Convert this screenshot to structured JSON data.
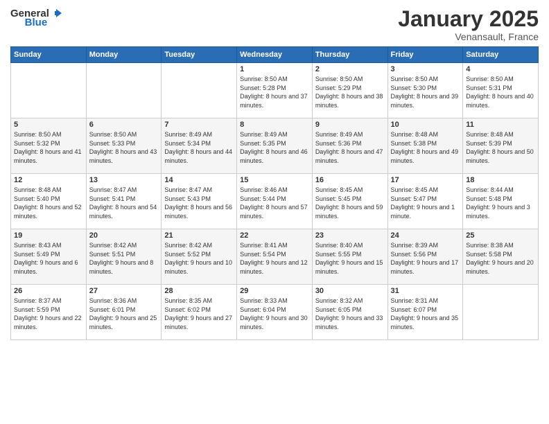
{
  "header": {
    "logo_general": "General",
    "logo_blue": "Blue",
    "title": "January 2025",
    "subtitle": "Venansault, France"
  },
  "days_of_week": [
    "Sunday",
    "Monday",
    "Tuesday",
    "Wednesday",
    "Thursday",
    "Friday",
    "Saturday"
  ],
  "weeks": [
    [
      {
        "day": "",
        "info": ""
      },
      {
        "day": "",
        "info": ""
      },
      {
        "day": "",
        "info": ""
      },
      {
        "day": "1",
        "info": "Sunrise: 8:50 AM\nSunset: 5:28 PM\nDaylight: 8 hours and 37 minutes."
      },
      {
        "day": "2",
        "info": "Sunrise: 8:50 AM\nSunset: 5:29 PM\nDaylight: 8 hours and 38 minutes."
      },
      {
        "day": "3",
        "info": "Sunrise: 8:50 AM\nSunset: 5:30 PM\nDaylight: 8 hours and 39 minutes."
      },
      {
        "day": "4",
        "info": "Sunrise: 8:50 AM\nSunset: 5:31 PM\nDaylight: 8 hours and 40 minutes."
      }
    ],
    [
      {
        "day": "5",
        "info": "Sunrise: 8:50 AM\nSunset: 5:32 PM\nDaylight: 8 hours and 41 minutes."
      },
      {
        "day": "6",
        "info": "Sunrise: 8:50 AM\nSunset: 5:33 PM\nDaylight: 8 hours and 43 minutes."
      },
      {
        "day": "7",
        "info": "Sunrise: 8:49 AM\nSunset: 5:34 PM\nDaylight: 8 hours and 44 minutes."
      },
      {
        "day": "8",
        "info": "Sunrise: 8:49 AM\nSunset: 5:35 PM\nDaylight: 8 hours and 46 minutes."
      },
      {
        "day": "9",
        "info": "Sunrise: 8:49 AM\nSunset: 5:36 PM\nDaylight: 8 hours and 47 minutes."
      },
      {
        "day": "10",
        "info": "Sunrise: 8:48 AM\nSunset: 5:38 PM\nDaylight: 8 hours and 49 minutes."
      },
      {
        "day": "11",
        "info": "Sunrise: 8:48 AM\nSunset: 5:39 PM\nDaylight: 8 hours and 50 minutes."
      }
    ],
    [
      {
        "day": "12",
        "info": "Sunrise: 8:48 AM\nSunset: 5:40 PM\nDaylight: 8 hours and 52 minutes."
      },
      {
        "day": "13",
        "info": "Sunrise: 8:47 AM\nSunset: 5:41 PM\nDaylight: 8 hours and 54 minutes."
      },
      {
        "day": "14",
        "info": "Sunrise: 8:47 AM\nSunset: 5:43 PM\nDaylight: 8 hours and 56 minutes."
      },
      {
        "day": "15",
        "info": "Sunrise: 8:46 AM\nSunset: 5:44 PM\nDaylight: 8 hours and 57 minutes."
      },
      {
        "day": "16",
        "info": "Sunrise: 8:45 AM\nSunset: 5:45 PM\nDaylight: 8 hours and 59 minutes."
      },
      {
        "day": "17",
        "info": "Sunrise: 8:45 AM\nSunset: 5:47 PM\nDaylight: 9 hours and 1 minute."
      },
      {
        "day": "18",
        "info": "Sunrise: 8:44 AM\nSunset: 5:48 PM\nDaylight: 9 hours and 3 minutes."
      }
    ],
    [
      {
        "day": "19",
        "info": "Sunrise: 8:43 AM\nSunset: 5:49 PM\nDaylight: 9 hours and 6 minutes."
      },
      {
        "day": "20",
        "info": "Sunrise: 8:42 AM\nSunset: 5:51 PM\nDaylight: 9 hours and 8 minutes."
      },
      {
        "day": "21",
        "info": "Sunrise: 8:42 AM\nSunset: 5:52 PM\nDaylight: 9 hours and 10 minutes."
      },
      {
        "day": "22",
        "info": "Sunrise: 8:41 AM\nSunset: 5:54 PM\nDaylight: 9 hours and 12 minutes."
      },
      {
        "day": "23",
        "info": "Sunrise: 8:40 AM\nSunset: 5:55 PM\nDaylight: 9 hours and 15 minutes."
      },
      {
        "day": "24",
        "info": "Sunrise: 8:39 AM\nSunset: 5:56 PM\nDaylight: 9 hours and 17 minutes."
      },
      {
        "day": "25",
        "info": "Sunrise: 8:38 AM\nSunset: 5:58 PM\nDaylight: 9 hours and 20 minutes."
      }
    ],
    [
      {
        "day": "26",
        "info": "Sunrise: 8:37 AM\nSunset: 5:59 PM\nDaylight: 9 hours and 22 minutes."
      },
      {
        "day": "27",
        "info": "Sunrise: 8:36 AM\nSunset: 6:01 PM\nDaylight: 9 hours and 25 minutes."
      },
      {
        "day": "28",
        "info": "Sunrise: 8:35 AM\nSunset: 6:02 PM\nDaylight: 9 hours and 27 minutes."
      },
      {
        "day": "29",
        "info": "Sunrise: 8:33 AM\nSunset: 6:04 PM\nDaylight: 9 hours and 30 minutes."
      },
      {
        "day": "30",
        "info": "Sunrise: 8:32 AM\nSunset: 6:05 PM\nDaylight: 9 hours and 33 minutes."
      },
      {
        "day": "31",
        "info": "Sunrise: 8:31 AM\nSunset: 6:07 PM\nDaylight: 9 hours and 35 minutes."
      },
      {
        "day": "",
        "info": ""
      }
    ]
  ]
}
